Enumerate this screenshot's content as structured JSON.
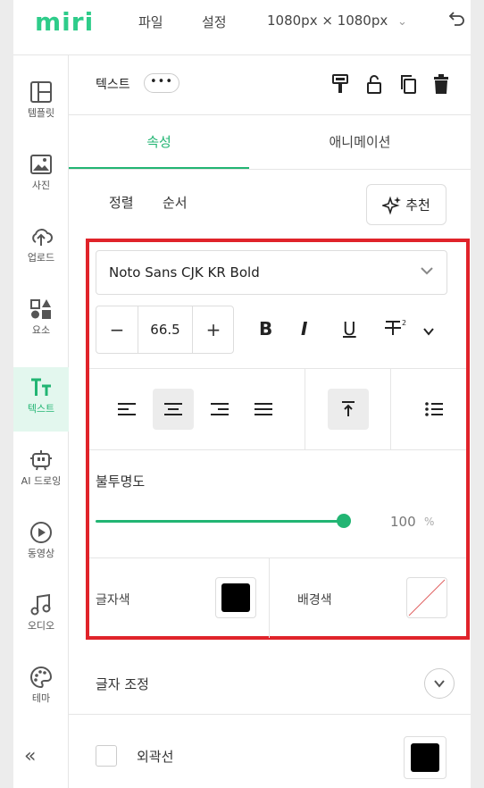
{
  "app": {
    "logo": "miri",
    "menu": [
      "파일",
      "설정"
    ],
    "canvas_size": "1080px × 1080px",
    "accent_color": "#22b573",
    "highlight_color": "#e0232a"
  },
  "sidebar": {
    "items": [
      {
        "label": "템플릿",
        "icon": "template-icon"
      },
      {
        "label": "사진",
        "icon": "photo-icon"
      },
      {
        "label": "업로드",
        "icon": "upload-icon"
      },
      {
        "label": "요소",
        "icon": "elements-icon"
      },
      {
        "label": "텍스트",
        "icon": "text-icon",
        "active": true
      },
      {
        "label": "AI 드로잉",
        "icon": "ai-drawing-icon"
      },
      {
        "label": "동영상",
        "icon": "video-icon"
      },
      {
        "label": "오디오",
        "icon": "audio-icon"
      },
      {
        "label": "테마",
        "icon": "theme-icon"
      }
    ],
    "collapse": "«"
  },
  "panel": {
    "title": "텍스트",
    "more": "•••",
    "tabs": [
      "속성",
      "애니메이션"
    ],
    "active_tab": "속성",
    "sub_tabs": [
      "정렬",
      "순서"
    ],
    "recommend_label": "추천",
    "font": {
      "name": "Noto Sans CJK KR Bold",
      "size": "66.5",
      "minus": "−",
      "plus": "+"
    },
    "format": {
      "bold": "B",
      "italic": "I",
      "underline": "U"
    },
    "opacity": {
      "label": "불투명도",
      "value": "100",
      "unit": "%",
      "level": 1.0
    },
    "colors": {
      "text_label": "글자색",
      "text_color": "#000000",
      "bg_label": "배경색",
      "bg_color": "none"
    },
    "text_adjust_label": "글자 조정",
    "outline": {
      "label": "외곽선",
      "color": "#000000",
      "checked": false
    }
  }
}
